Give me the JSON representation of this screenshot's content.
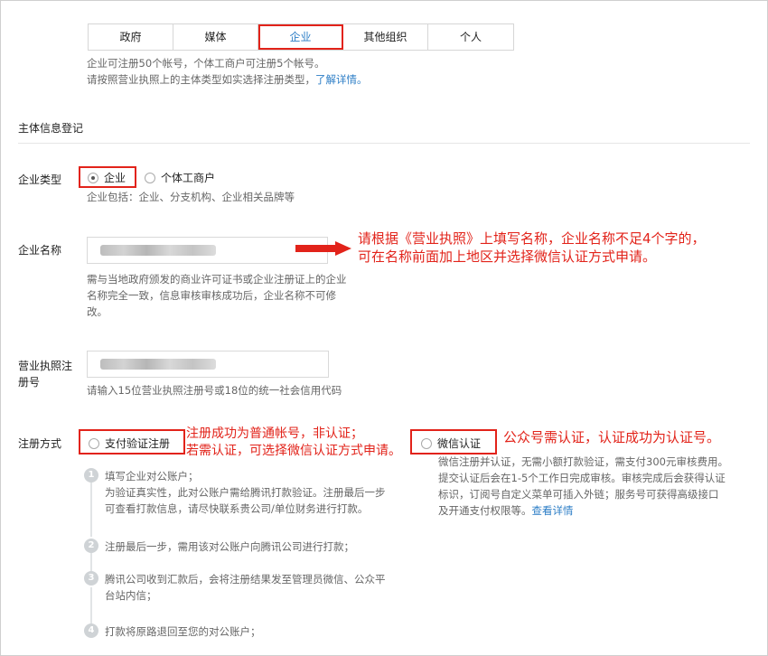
{
  "tabs": [
    "政府",
    "媒体",
    "企业",
    "其他组织",
    "个人"
  ],
  "tab_active": "企业",
  "intro": {
    "line1": "企业可注册50个帐号，个体工商户可注册5个帐号。",
    "line2_prefix": "请按照营业执照上的主体类型如实选择注册类型，",
    "line2_link": "了解详情。"
  },
  "section_title": "主体信息登记",
  "enterprise_type": {
    "label": "企业类型",
    "option1": "企业",
    "option2": "个体工商户",
    "hint": "企业包括：企业、分支机构、企业相关品牌等"
  },
  "enterprise_name": {
    "label": "企业名称",
    "hint1": "需与当地政府颁发的商业许可证书或企业注册证上的企业",
    "hint2": "名称完全一致，信息审核审核成功后，企业名称不可修",
    "hint3": "改。"
  },
  "license": {
    "label1": "营业执照注",
    "label2": "册号",
    "hint": "请输入15位营业执照注册号或18位的统一社会信用代码"
  },
  "reg_method": {
    "label": "注册方式",
    "option1": "支付验证注册",
    "option2": "微信认证",
    "wx_desc1": "微信注册并认证，无需小额打款验证，需支付300元审核费用。",
    "wx_desc2": "提交认证后会在1-5个工作日完成审核。审核完成后会获得认证",
    "wx_desc3": "标识，订阅号自定义菜单可插入外链；服务号可获得高级接口",
    "wx_desc4_prefix": "及开通支付权限等。",
    "wx_desc4_link": "查看详情"
  },
  "steps": [
    {
      "num": "1",
      "lines": [
        "填写企业对公账户；",
        "为验证真实性，此对公账户需给腾讯打款验证。注册最后一步",
        "可查看打款信息，请尽快联系贵公司/单位财务进行打款。"
      ]
    },
    {
      "num": "2",
      "lines": [
        "注册最后一步，需用该对公账户向腾讯公司进行打款；"
      ]
    },
    {
      "num": "3",
      "lines": [
        "腾讯公司收到汇款后，会将注册结果发至管理员微信、公众平",
        "台站内信；"
      ]
    },
    {
      "num": "4",
      "lines": [
        "打款将原路退回至您的对公账户；"
      ]
    }
  ],
  "annotations": {
    "name_note1": "请根据《营业执照》上填写名称，企业名称不足4个字的，",
    "name_note2": "可在名称前面加上地区并选择微信认证方式申请。",
    "pay_note1": "注册成功为普通帐号，非认证；",
    "pay_note2": "若需认证，可选择微信认证方式申请。",
    "wx_note": "公众号需认证，认证成功为认证号。"
  },
  "colors": {
    "annotation_red": "#e2231a",
    "link_blue": "#2b7dc6"
  }
}
